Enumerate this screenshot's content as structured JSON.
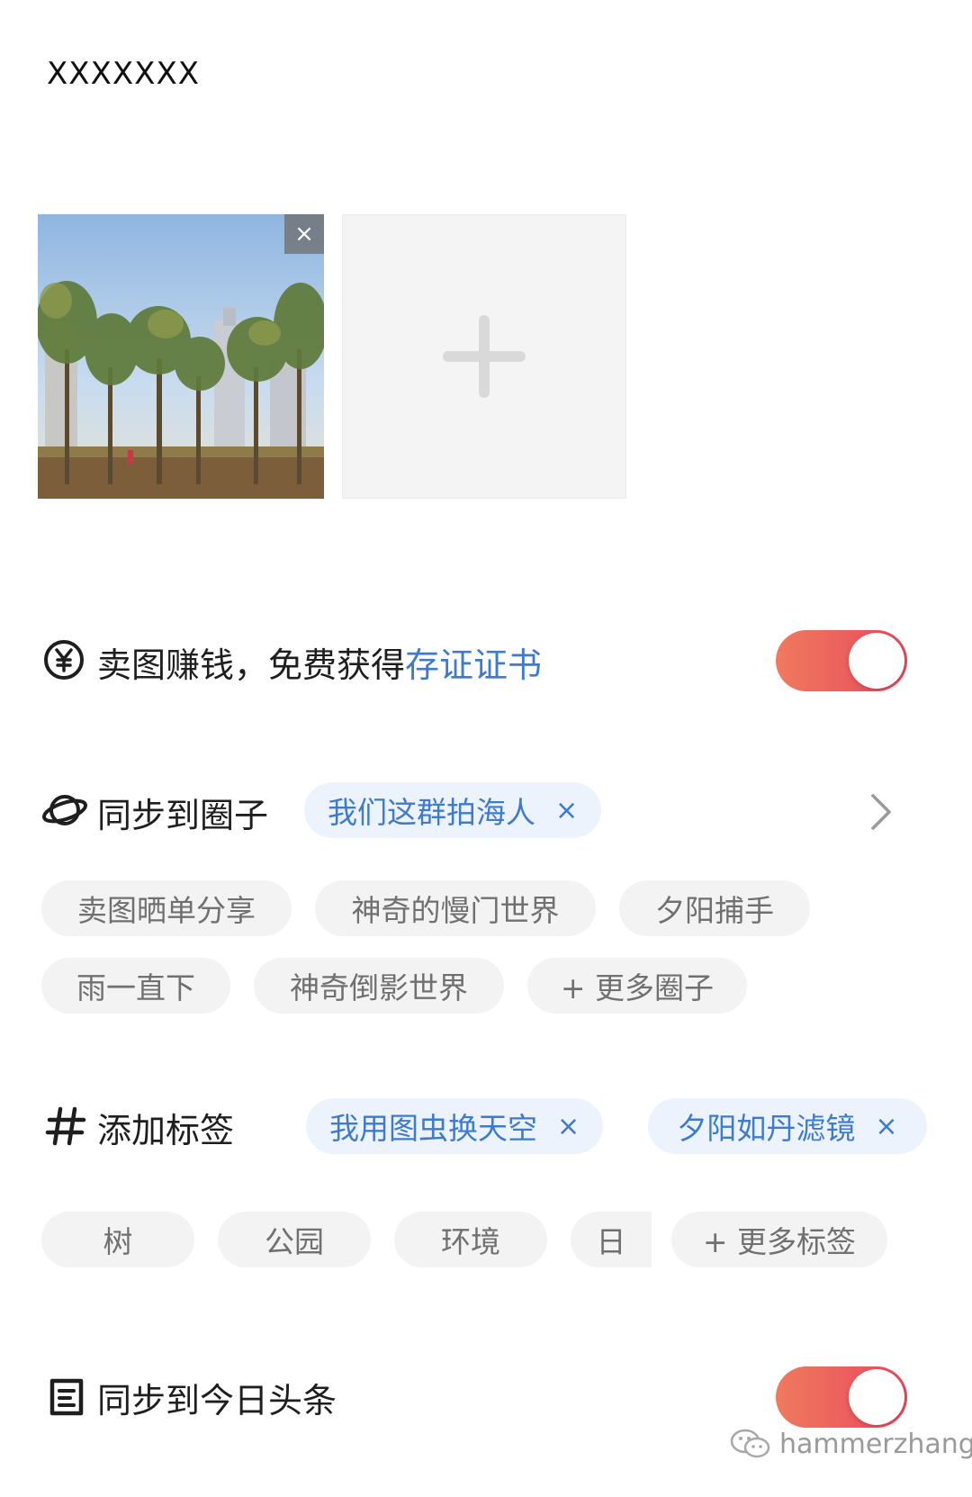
{
  "caption": "XXXXXXX",
  "photos": {
    "remove_glyph": "×",
    "add_icon": "plus-icon"
  },
  "sell": {
    "label_prefix": "卖图赚钱，免费获得",
    "label_link": "存证证书",
    "icon": "yen-circle-icon",
    "toggle_on": true
  },
  "circle": {
    "label": "同步到圈子",
    "icon": "planet-icon",
    "selected": [
      {
        "label": "我们这群拍海人"
      }
    ],
    "suggestions": [
      "卖图晒单分享",
      "神奇的慢门世界",
      "夕阳捕手",
      "雨一直下",
      "神奇倒影世界",
      "+ 更多圈子"
    ]
  },
  "tags": {
    "label": "添加标签",
    "icon": "hashtag-icon",
    "selected": [
      {
        "label": "我用图虫换天空"
      },
      {
        "label": "夕阳如丹滤镜"
      }
    ],
    "suggestions": [
      "树",
      "公园",
      "环境",
      "日",
      "+ 更多标签"
    ]
  },
  "toutiao": {
    "label": "同步到今日头条",
    "icon": "toutiao-icon",
    "toggle_on": true
  },
  "chip_close_glyph": "×",
  "watermark": "hammerzhang",
  "colors": {
    "accent_blue": "#3d7bd0",
    "toggle_start": "#f07a5e",
    "toggle_end": "#e9485d",
    "chip_bg": "#f3f3f3",
    "selected_chip_bg": "#edf3fc"
  }
}
